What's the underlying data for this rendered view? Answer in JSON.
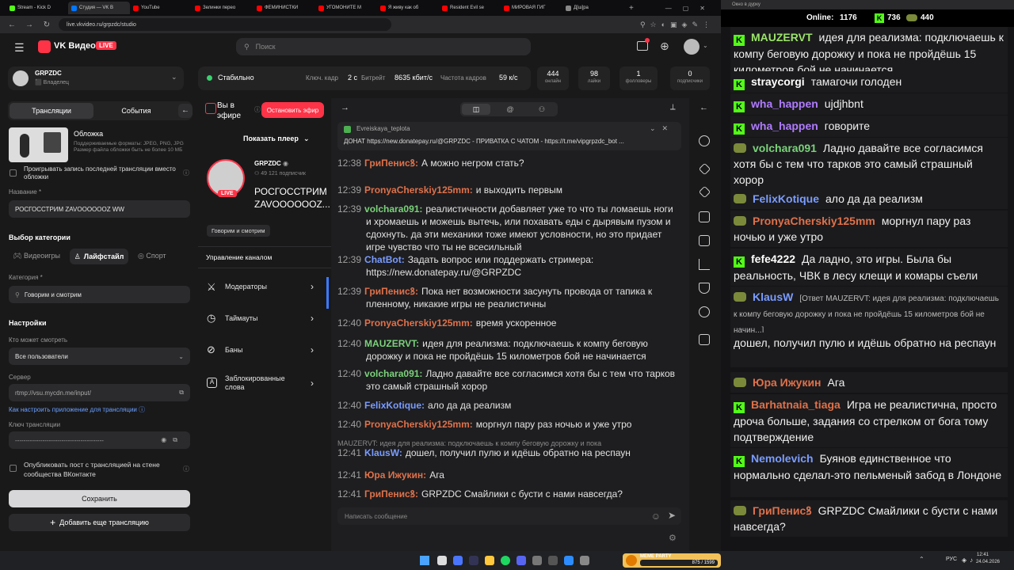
{
  "browser": {
    "tabs": [
      "Stream - Kick D",
      "Студия — VK В",
      "YouTube",
      "Зелинки перео",
      "ФЕМИНИСТКИ",
      "УГОМОНИТЕ М",
      "Я живу как об",
      "Resident Evil se",
      "МИРОВАЯ ГИГ",
      "Д[ш]ра"
    ],
    "url": "live.vkvideo.ru/grpzdc/studio"
  },
  "vk": {
    "logo_text": "VK Видео",
    "live_badge": "LIVE",
    "search_placeholder": "Поиск",
    "channel_name": "GRPZDC",
    "channel_role": "Владелец",
    "status": "Стабильно",
    "metrics": {
      "keyframe_label": "Ключ. кадр",
      "keyframe_value": "2 с",
      "bitrate_label": "Битрейт",
      "bitrate_value": "8635 кбит/с",
      "fps_label": "Частота кадров",
      "fps_value": "59 к/с"
    },
    "stats": [
      {
        "value": "444",
        "label": "онлайн"
      },
      {
        "value": "98",
        "label": "лайки"
      },
      {
        "value": "1",
        "label": "фолловеры"
      },
      {
        "value": "0",
        "label": "подписчики"
      }
    ],
    "tabs": {
      "broadcasts": "Трансляции",
      "events": "События"
    },
    "cover_title": "Обложка",
    "cover_desc": "Поддерживаемые форматы: JPEG, PNG, JPG Размер файла обложки быть не более 10 МБ",
    "cover_replay": "Проигрывать запись последней трансляции вместо обложки",
    "name_label": "Название *",
    "name_value": "РОСГОССТРИМ ZAVOOOOOOZ WW",
    "category_section": "Выбор категории",
    "cat_tabs": [
      "Видеоигры",
      "Лайфстайл",
      "Спорт"
    ],
    "category_label": "Категория *",
    "category_value": "Говорим и смотрим",
    "settings_title": "Настройки",
    "who_label": "Кто может смотреть",
    "who_value": "Все пользователи",
    "server_label": "Сервер",
    "server_value": "rtmp://vsu.mycdn.me/input/",
    "howto_link": "Как настроить приложение для трансляции",
    "key_label": "Ключ трансляции",
    "key_value": "------------------------------------------",
    "publish_label": "Опубликовать пост с трансляцией на стене сообщества ВКонтакте",
    "save_btn": "Сохранить",
    "add_btn": "Добавить еще трансляцию",
    "on_air": "Вы в эфире",
    "stop_btn": "Остановить эфир",
    "show_player": "Показать плеер",
    "stream_channel": "GRPZDC",
    "subs": "49 121 подписчик",
    "stream_title": "РОСГОССТРИМ ZAVOOOOOOZ...",
    "stream_tag": "Говорим и смотрим",
    "manage_title": "Управление каналом",
    "manage_items": [
      "Модераторы",
      "Таймауты",
      "Баны",
      "Заблокированные слова"
    ],
    "pinned_user": "Evreiskaya_teplota",
    "pinned_text": "ДОНАТ https://new.donatepay.ru/@GRPZDC - ПРИВАТКА С ЧАТОМ - https://t.me/vipgrpzdc_bot ...",
    "chat_placeholder": "Написать сообщение",
    "chat": [
      {
        "t": "12:38",
        "u": "ГриПенисꝸ:",
        "c": "#e0714a",
        "m": "А можно негром стать?"
      },
      {
        "t": "12:39",
        "u": "PronyaCherskiy125mm:",
        "c": "#e0714a",
        "m": "и выходить первым"
      },
      {
        "t": "12:39",
        "u": "volchara091:",
        "c": "#7bd27b",
        "m": "реалистичности добавляет уже то что ты ломаешь ноги и хромаешь и можешь вытечь, или похавать еды с дырявым пузом и сдохнуть. да эти механики тоже имеют условности, но это придает игре чувство что ты не всесильный"
      },
      {
        "t": "12:39",
        "u": "ChatBot:",
        "c": "#7a9cff",
        "m": "Задать вопрос или поддержать стримера: https://new.donatepay.ru/@GRPZDC"
      },
      {
        "t": "12:39",
        "u": "ГриПенисꝸ:",
        "c": "#e0714a",
        "m": "Пока нет возможности засунуть провода от тапика к пленному, никакие игры не реалистичны"
      },
      {
        "t": "12:40",
        "u": "PronyaCherskiy125mm:",
        "c": "#e0714a",
        "m": "время ускоренное"
      },
      {
        "t": "12:40",
        "u": "MAUZERVT:",
        "c": "#7bd27b",
        "m": "идея для реализма: подключаешь к компу беговую дорожку и пока не пройдёшь 15 километров бой не начинается"
      },
      {
        "t": "12:40",
        "u": "volchara091:",
        "c": "#7bd27b",
        "m": "Ладно давайте все согласимся хотя бы с тем что тарков это самый страшный хорор"
      },
      {
        "t": "12:40",
        "u": "FelixKotique:",
        "c": "#7a9cff",
        "m": "ало да да реализм"
      },
      {
        "t": "12:40",
        "u": "PronyaCherskiy125mm:",
        "c": "#e0714a",
        "m": "моргнул пару раз ночью и уже утро"
      },
      {
        "t": "12:41",
        "u": "KlausW:",
        "c": "#7a9cff",
        "m": "дошел, получил пулю и идёшь обратно на респаун"
      },
      {
        "t": "12:41",
        "u": "Юра Ижукин:",
        "c": "#e0714a",
        "m": "Ага"
      },
      {
        "t": "12:41",
        "u": "ГриПенисꝸ:",
        "c": "#e0714a",
        "m": "GRPZDC Смайлики с бусти с нами навсегда?"
      }
    ],
    "reply_quote": "MAUZERVT: идея для реализма: подключаешь к компу беговую дорожку и пока"
  },
  "obs": {
    "window_title": "Окно в дурку",
    "online_label": "Online:",
    "online_value": "1176",
    "kick_count": "736",
    "vk_count": "440",
    "messages": [
      {
        "u": "MAUZERVT",
        "c": "#9be36a",
        "src": "kick",
        "m": "идея для реализма: подключаешь к компу беговую дорожку и пока не пройдёшь 15 километров бой не начинается"
      },
      {
        "u": "straycorgi",
        "c": "#ffffff",
        "src": "kick",
        "m": "тамагочи голоден"
      },
      {
        "u": "wha_happen",
        "c": "#b07cff",
        "src": "kick",
        "m": "ujdjhbnt"
      },
      {
        "u": "wha_happen",
        "c": "#b07cff",
        "src": "kick",
        "m": "говорите"
      },
      {
        "u": "volchara091",
        "c": "#7bd27b",
        "src": "vk",
        "m": "Ладно давайте все согласимся хотя бы с тем что тарков это самый страшный хорор"
      },
      {
        "u": "FelixKotique",
        "c": "#7a9cff",
        "src": "vk",
        "m": "ало да да реализм"
      },
      {
        "u": "PronyaCherskiy125mm",
        "c": "#e0714a",
        "src": "vk",
        "m": "моргнул пару раз ночью и уже утро"
      },
      {
        "u": "fefe4222",
        "c": "#ffffff",
        "src": "kick",
        "m": "Да ладно, это игры. Была бы реальность, ЧВК в лесу клещи и комары съели"
      },
      {
        "u": "KlausW",
        "c": "#7a9cff",
        "src": "vk",
        "m": "[Ответ MAUZERVT: идея для реализма: подключаешь к компу беговую дорожку и пока не пройдёшь 15 километров бой не начин...]"
      },
      {
        "u": "",
        "c": "#ffffff",
        "src": "none",
        "m": "дошел, получил пулю и идёшь обратно на респаун"
      },
      {
        "u": "Юра Ижукин",
        "c": "#e0714a",
        "src": "vk",
        "m": "Ага"
      },
      {
        "u": "Barhatnaia_tiaga",
        "c": "#e0714a",
        "src": "kick",
        "m": "Игра не реалистична, просто дроча больше, задания со стрелком от бога тому подтверждение"
      },
      {
        "u": "Nemolevich",
        "c": "#7a9cff",
        "src": "kick",
        "m": "Буянов единственное что нормально сделал-это пельменый забод в Лондоне"
      },
      {
        "u": "ГриПенисꝸ",
        "c": "#e0714a",
        "src": "vk",
        "m": "GRPZDC Смайлики с бусти с нами навсегда?"
      }
    ]
  },
  "taskbar": {
    "lang": "РУС",
    "time": "12:41",
    "date": "24.04.2026",
    "widget_title": "MEME PARTY",
    "widget_counter": "875 / 1599"
  }
}
